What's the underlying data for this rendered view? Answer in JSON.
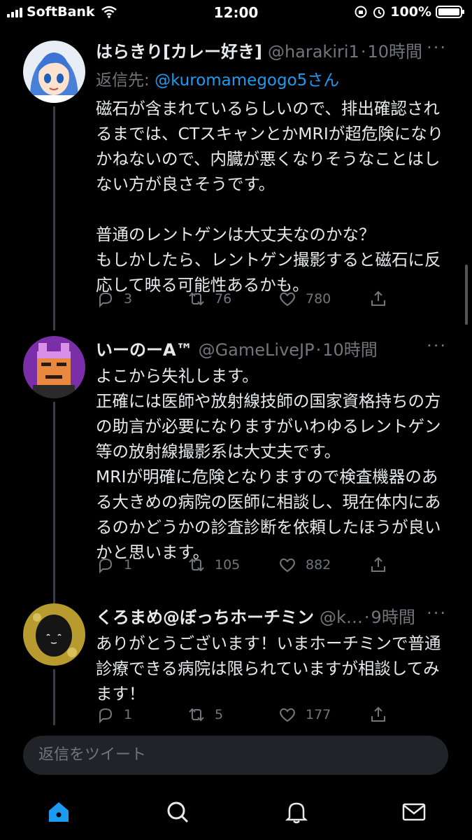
{
  "status": {
    "carrier": "SoftBank",
    "time": "12:00",
    "battery": "100%"
  },
  "tweets": [
    {
      "name": "はらきり[カレー好き]",
      "handle": "@harakiri1",
      "time": "10時間",
      "reply_prefix": "返信先: ",
      "reply_mention": "@kuromamegogo5さん",
      "text": "磁石が含まれているらしいので、排出確認されるまでは、CTスキャンとかMRIが超危険になりかねないので、内臓が悪くなりそうなことはしない方が良さそうです。\n\n普通のレントゲンは大丈夫なのかな？\nもしかしたら、レントゲン撮影すると磁石に反応して映る可能性あるかも。",
      "replies": "3",
      "retweets": "76",
      "likes": "780"
    },
    {
      "name": "いーのーA™",
      "handle": "@GameLiveJP",
      "time": "10時間",
      "text": "よこから失礼します。\n正確には医師や放射線技師の国家資格持ちの方の助言が必要になりますがいわゆるレントゲン等の放射線撮影系は大丈夫です。\nMRIが明確に危険となりますので検査機器のある大きめの病院の医師に相談し、現在体内にあるのかどうかの診査診断を依頼したほうが良いかと思います。",
      "replies": "1",
      "retweets": "105",
      "likes": "882"
    },
    {
      "name": "くろまめ@ぼっちホーチミン",
      "handle": "@k…",
      "time": "9時間",
      "text": "ありがとうございます！いまホーチミンで普通診療できる病院は限られていますが相談してみます！",
      "replies": "1",
      "retweets": "5",
      "likes": "177"
    }
  ],
  "composer": {
    "placeholder": "返信をツイート"
  },
  "colors": {
    "accent": "#1d9bf0",
    "muted": "#71767b",
    "text": "#e7e9ea",
    "bg": "#000000"
  },
  "icons": {
    "more": "more-dots-icon",
    "reply": "reply-icon",
    "retweet": "retweet-icon",
    "like": "heart-icon",
    "share": "share-icon",
    "tabs": [
      "home-icon",
      "search-icon",
      "notifications-icon",
      "messages-icon"
    ]
  }
}
